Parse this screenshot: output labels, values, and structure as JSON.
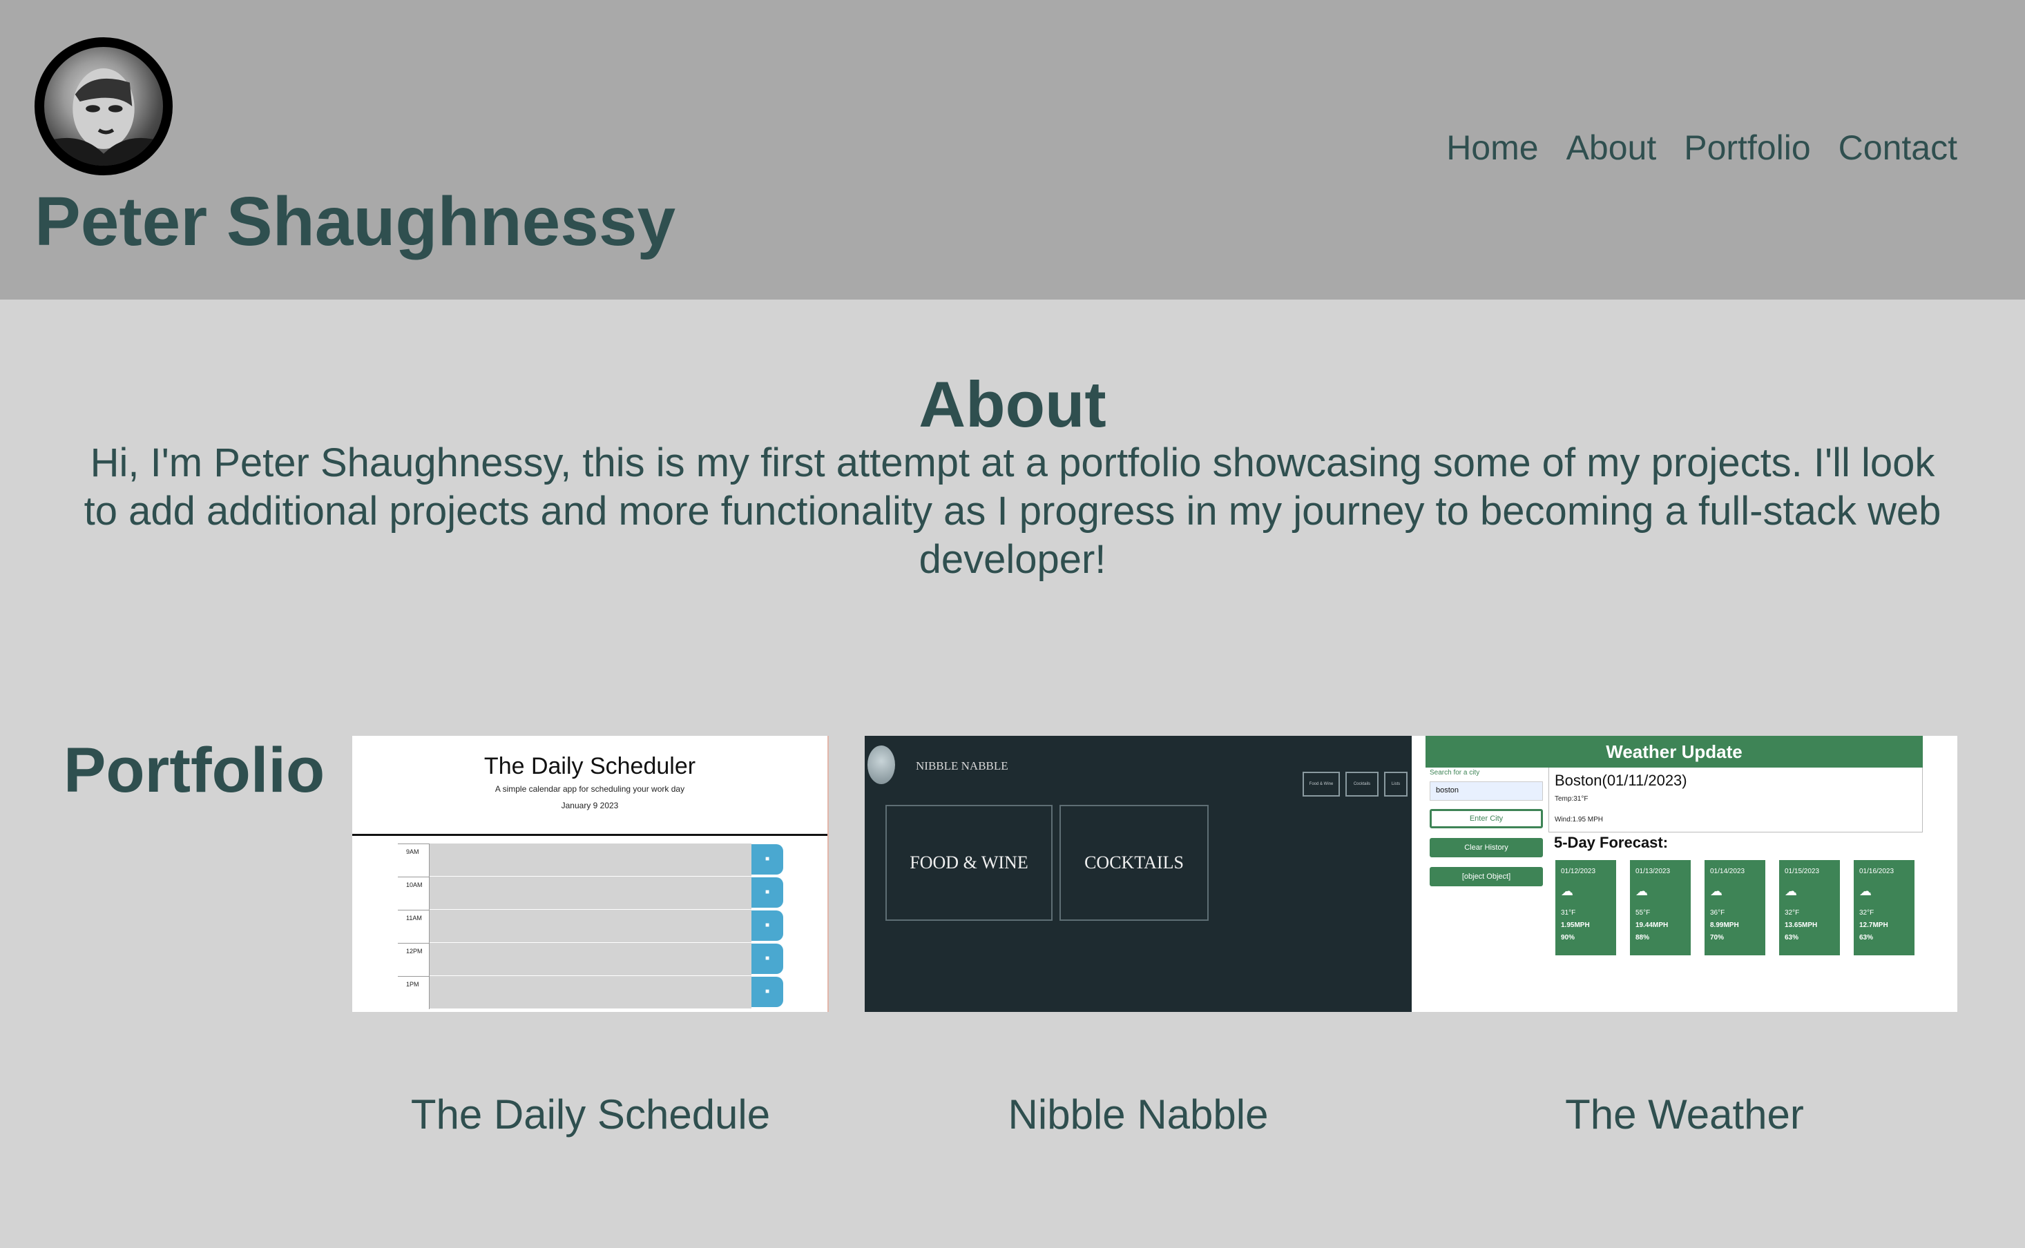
{
  "header": {
    "site_name": "Peter Shaughnessy",
    "nav": [
      "Home",
      "About",
      "Portfolio",
      "Contact"
    ]
  },
  "about": {
    "title": "About",
    "text": "Hi, I'm Peter Shaughnessy, this is my first attempt at a portfolio showcasing some of my projects. I'll look to add additional projects and more functionality as I progress in my journey to becoming a full-stack web developer!"
  },
  "portfolio": {
    "title": "Portfolio",
    "projects": [
      {
        "label": "The Daily Schedule",
        "thumb": {
          "title": "The Daily Scheduler",
          "subtitle": "A simple calendar app for scheduling your work day",
          "date": "January 9 2023",
          "hours": [
            "9AM",
            "10AM",
            "11AM",
            "12PM",
            "1PM"
          ]
        }
      },
      {
        "label": "Nibble Nabble",
        "thumb": {
          "brand": "NIBBLE NABBLE",
          "buttons": [
            "Food & Wine",
            "Cocktails",
            "Lists"
          ],
          "boxes": [
            "FOOD & WINE",
            "COCKTAILS"
          ]
        }
      },
      {
        "label": "The Weather",
        "thumb": {
          "header": "Weather Update",
          "search_label": "Search for a city",
          "search_value": "boston",
          "enter_button": "Enter City",
          "clear_button": "Clear History",
          "history_button": "[object Object]",
          "city": "Boston(01/11/2023)",
          "temp": "Temp:31°F",
          "wind": "Wind:1.95 MPH",
          "forecast_title": "5-Day Forecast:",
          "forecast": [
            {
              "date": "01/12/2023",
              "temp": "31°F",
              "wind": "1.95MPH",
              "humidity": "90%"
            },
            {
              "date": "01/13/2023",
              "temp": "55°F",
              "wind": "19.44MPH",
              "humidity": "88%"
            },
            {
              "date": "01/14/2023",
              "temp": "36°F",
              "wind": "8.99MPH",
              "humidity": "70%"
            },
            {
              "date": "01/15/2023",
              "temp": "32°F",
              "wind": "13.65MPH",
              "humidity": "63%"
            },
            {
              "date": "01/16/2023",
              "temp": "32°F",
              "wind": "12.7MPH",
              "humidity": "63%"
            }
          ]
        }
      }
    ]
  },
  "colors": {
    "header_bg": "#a9a9a9",
    "page_bg": "#d3d3d3",
    "text": "#2f4f4f",
    "weather_green": "#3e8456",
    "scheduler_blue": "#4aa8d0",
    "nibble_bg": "#1e2b30"
  }
}
